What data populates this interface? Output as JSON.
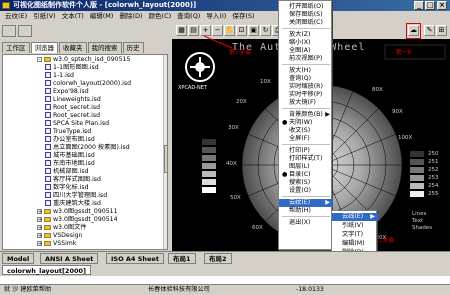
{
  "window": {
    "title": "可视化图纸制作软件个人版 - [colorwh_layout(2000)]",
    "min": "_",
    "max": "□",
    "close": "×"
  },
  "menubar": [
    "云纹(E)",
    "引纸(V)",
    "文本(T)",
    "编辑(M)",
    "删除(D)",
    "颜色(C)",
    "查询(Q)",
    "导入(I)",
    "保存(S)"
  ],
  "left_tabs": [
    "工作区",
    "浏览器",
    "收藏夹",
    "我的搜索",
    "历史"
  ],
  "tree": [
    {
      "label": "w3.0_sptech_isd_090515",
      "type": "folder",
      "indent": 1,
      "toggle": "-"
    },
    {
      "label": "1-1图形图图.isd",
      "type": "file"
    },
    {
      "label": "1-1.isd",
      "type": "file"
    },
    {
      "label": "colorwh_layout(2000).isd",
      "type": "file"
    },
    {
      "label": "Expo'98.isd",
      "type": "file"
    },
    {
      "label": "Lineweights.isd",
      "type": "file"
    },
    {
      "label": "Root_secret.isd",
      "type": "file"
    },
    {
      "label": "Root_secret.isd",
      "type": "file"
    },
    {
      "label": "SPCA Site Plan.isd",
      "type": "file"
    },
    {
      "label": "TrueType.isd",
      "type": "file"
    },
    {
      "label": "办公室布图.isd",
      "type": "file"
    },
    {
      "label": "总立面图(2000 按素图).isd",
      "type": "file"
    },
    {
      "label": "城市基础图.isd",
      "type": "file"
    },
    {
      "label": "东南市地图.isd",
      "type": "file"
    },
    {
      "label": "机械部图.isd",
      "type": "file"
    },
    {
      "label": "客厅样式图图.isd",
      "type": "file"
    },
    {
      "label": "数字化标.isd",
      "type": "file"
    },
    {
      "label": "四川大学管理图.isd",
      "type": "file"
    },
    {
      "label": "重庆建筑大楼.isd",
      "type": "file"
    },
    {
      "label": "w3.0图gssdt_090511",
      "type": "folder",
      "indent": 1,
      "toggle": "+"
    },
    {
      "label": "w3.0图gssdt_090514",
      "type": "folder",
      "indent": 1,
      "toggle": "+"
    },
    {
      "label": "w3.0图文件",
      "type": "folder",
      "indent": 1,
      "toggle": "+"
    },
    {
      "label": "VSDesign",
      "type": "folder",
      "indent": 1,
      "toggle": "+"
    },
    {
      "label": "VSSimk",
      "type": "folder",
      "indent": 1,
      "toggle": "+"
    }
  ],
  "canvas": {
    "title": "The Aut  Color Wheel",
    "logo_text": "XPCAD-NET",
    "swatch_labels": [
      "250",
      "251",
      "252",
      "253",
      "254",
      "255"
    ],
    "ring_labels": [
      "10X",
      "20X",
      "30X",
      "40X",
      "50X",
      "60X",
      "80X",
      "90X",
      "100X",
      "120X"
    ],
    "legend_labels": [
      "Lines",
      "Text",
      "Shades"
    ]
  },
  "dropdown": [
    {
      "label": "打开图纸(O)"
    },
    {
      "label": "保存图纸(S)"
    },
    {
      "label": "关闭图纸(C)"
    },
    {
      "sep": true
    },
    {
      "label": "放大(Z)"
    },
    {
      "label": "缩小(X)"
    },
    {
      "label": "全图(A)"
    },
    {
      "label": "前次视图(P)"
    },
    {
      "sep": true
    },
    {
      "label": "放大(H)"
    },
    {
      "label": "查询(Q)"
    },
    {
      "label": "实时缩放(R)"
    },
    {
      "label": "实时平移(P)"
    },
    {
      "label": "放大镜(F)"
    },
    {
      "sep": true
    },
    {
      "label": "背景颜色(B)",
      "arrow": "▶"
    },
    {
      "label": "天阴(W)",
      "check": "●"
    },
    {
      "label": "收文(S)"
    },
    {
      "label": "全屏(F)"
    },
    {
      "sep": true
    },
    {
      "label": "打印(P)"
    },
    {
      "label": "打印样式(T)"
    },
    {
      "label": "图层(L)"
    },
    {
      "label": "目录(C)",
      "check": "●"
    },
    {
      "label": "搜索(S)"
    },
    {
      "label": "设置(O)"
    },
    {
      "sep": true
    },
    {
      "label": "云纹(E)",
      "arrow": "▶",
      "selected": true
    },
    {
      "label": "帮助(H)"
    },
    {
      "sep": true
    },
    {
      "label": "退出(X)"
    }
  ],
  "submenu": [
    {
      "label": "云线(E)",
      "arrow": "▶",
      "selected": true
    },
    {
      "label": "引纸(V)"
    },
    {
      "label": "文字(T)"
    },
    {
      "label": "编辑(M)"
    },
    {
      "label": "删除(D)"
    },
    {
      "label": "颜色(C)"
    },
    {
      "label": "查询(Q)"
    },
    {
      "label": "导入(I)"
    },
    {
      "label": "保存(S)"
    }
  ],
  "annotations": {
    "a1": "第三步骤",
    "a2": "第一步",
    "a3": "第二步骤"
  },
  "layout_tabs": [
    "Model",
    "ANSI A Sheet",
    "ISO A4 Sheet",
    "布局1",
    "布局2"
  ],
  "file_tab": "colorwh_layout[2000]",
  "status": {
    "left": "就 沙 建欧菜帮助",
    "mid": "长春体验科技有限公司",
    "coords": "-18.0133"
  }
}
